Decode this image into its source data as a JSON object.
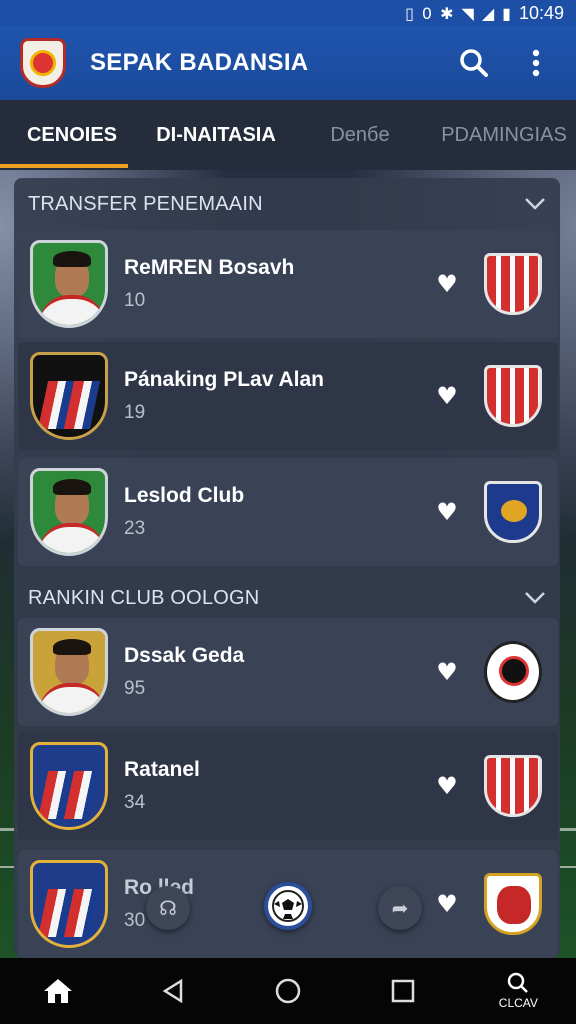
{
  "status_bar": {
    "time": "10:49"
  },
  "app_bar": {
    "title": "SEPAK BADANSIA",
    "search_icon": "search-icon",
    "more_icon": "more-vert-icon"
  },
  "tabs": [
    {
      "label": "CENOIES",
      "active": true
    },
    {
      "label": "DI-NAITASIA",
      "active": false
    },
    {
      "label": "Denбe",
      "active": false
    },
    {
      "label": "PDAMINGIAS",
      "active": false
    }
  ],
  "sections": [
    {
      "title": "TRANSFER PENEMAAIN",
      "items": [
        {
          "name": "ReMREN Bosavh",
          "number": "10"
        },
        {
          "name": "Pánaking PLav Alan",
          "number": "19"
        },
        {
          "name": "Leslod Club",
          "number": "23"
        }
      ]
    },
    {
      "title": "RANKIN CLUB OOLOGN",
      "items": [
        {
          "name": "Dssak Geda",
          "number": "95"
        },
        {
          "name": "Ratanel",
          "number": "34"
        },
        {
          "name": "Ro    lled",
          "number": "30"
        }
      ]
    }
  ],
  "nav": {
    "search_label": "CLCAV"
  },
  "colors": {
    "app_bar": "#1c4fa5",
    "tab_indicator": "#f0a020",
    "panel": "#343c4e"
  }
}
